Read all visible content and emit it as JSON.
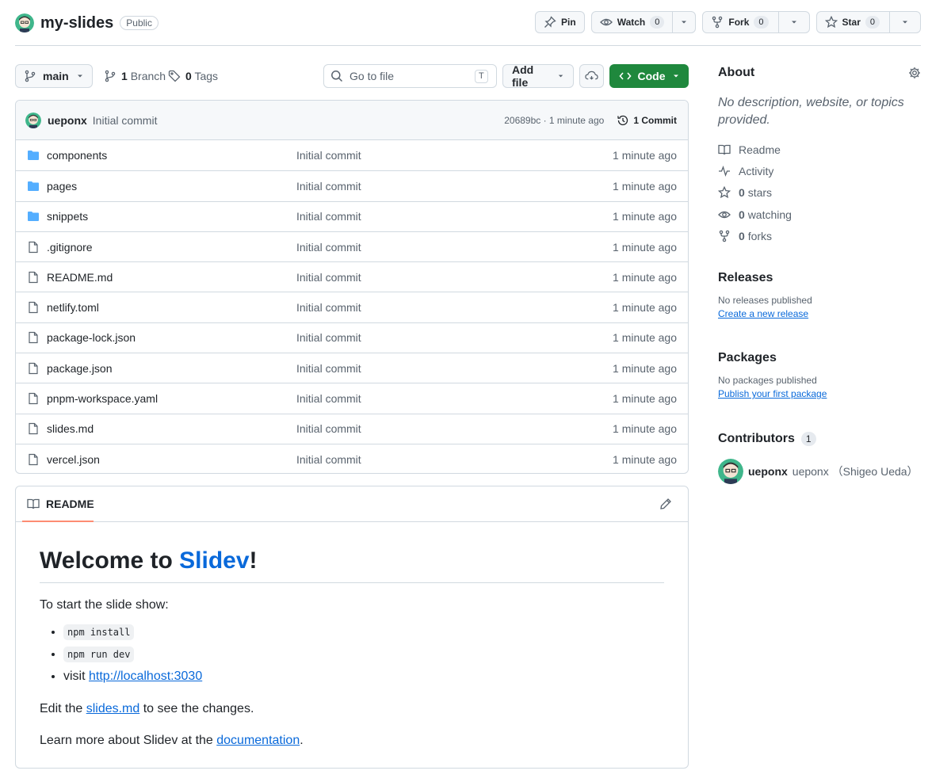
{
  "repo": {
    "name": "my-slides",
    "visibility": "Public",
    "actions": {
      "pin": "Pin",
      "watch": "Watch",
      "watch_count": "0",
      "fork": "Fork",
      "fork_count": "0",
      "star": "Star",
      "star_count": "0"
    }
  },
  "toolbar": {
    "branch": "main",
    "branches_count": "1",
    "branches_label": "Branch",
    "tags_count": "0",
    "tags_label": "Tags",
    "search_placeholder": "Go to file",
    "search_shortcut": "T",
    "add_file": "Add file",
    "code": "Code"
  },
  "latest_commit": {
    "author": "ueponx",
    "message": "Initial commit",
    "meta": "20689bc · 1 minute ago",
    "commits": "1 Commit"
  },
  "files": [
    {
      "name": "components",
      "type": "dir",
      "commit": "Initial commit",
      "age": "1 minute ago"
    },
    {
      "name": "pages",
      "type": "dir",
      "commit": "Initial commit",
      "age": "1 minute ago"
    },
    {
      "name": "snippets",
      "type": "dir",
      "commit": "Initial commit",
      "age": "1 minute ago"
    },
    {
      "name": ".gitignore",
      "type": "file",
      "commit": "Initial commit",
      "age": "1 minute ago"
    },
    {
      "name": "README.md",
      "type": "file",
      "commit": "Initial commit",
      "age": "1 minute ago"
    },
    {
      "name": "netlify.toml",
      "type": "file",
      "commit": "Initial commit",
      "age": "1 minute ago"
    },
    {
      "name": "package-lock.json",
      "type": "file",
      "commit": "Initial commit",
      "age": "1 minute ago"
    },
    {
      "name": "package.json",
      "type": "file",
      "commit": "Initial commit",
      "age": "1 minute ago"
    },
    {
      "name": "pnpm-workspace.yaml",
      "type": "file",
      "commit": "Initial commit",
      "age": "1 minute ago"
    },
    {
      "name": "slides.md",
      "type": "file",
      "commit": "Initial commit",
      "age": "1 minute ago"
    },
    {
      "name": "vercel.json",
      "type": "file",
      "commit": "Initial commit",
      "age": "1 minute ago"
    }
  ],
  "readme": {
    "tab": "README",
    "title_prefix": "Welcome to ",
    "title_link": "Slidev",
    "title_suffix": "!",
    "intro": "To start the slide show:",
    "steps": [
      "npm install",
      "npm run dev"
    ],
    "visit_prefix": "visit ",
    "visit_link": "http://localhost:3030",
    "edit_prefix": "Edit the ",
    "edit_link": "slides.md",
    "edit_suffix": " to see the changes.",
    "learn_prefix": "Learn more about Slidev at the ",
    "learn_link": "documentation",
    "learn_suffix": "."
  },
  "about": {
    "title": "About",
    "description": "No description, website, or topics provided.",
    "readme": "Readme",
    "activity": "Activity",
    "stars_count": "0",
    "stars_label": "stars",
    "watching_count": "0",
    "watching_label": "watching",
    "forks_count": "0",
    "forks_label": "forks"
  },
  "releases": {
    "title": "Releases",
    "empty": "No releases published",
    "link": "Create a new release"
  },
  "packages": {
    "title": "Packages",
    "empty": "No packages published",
    "link": "Publish your first package"
  },
  "contributors": {
    "title": "Contributors",
    "count": "1",
    "login": "ueponx",
    "name": "ueponx （Shigeo Ueda）"
  },
  "colors": {
    "accent": "#0969da",
    "code_button": "#1f883d",
    "folder": "#54aeff",
    "tab_underline": "#fd8c73"
  }
}
